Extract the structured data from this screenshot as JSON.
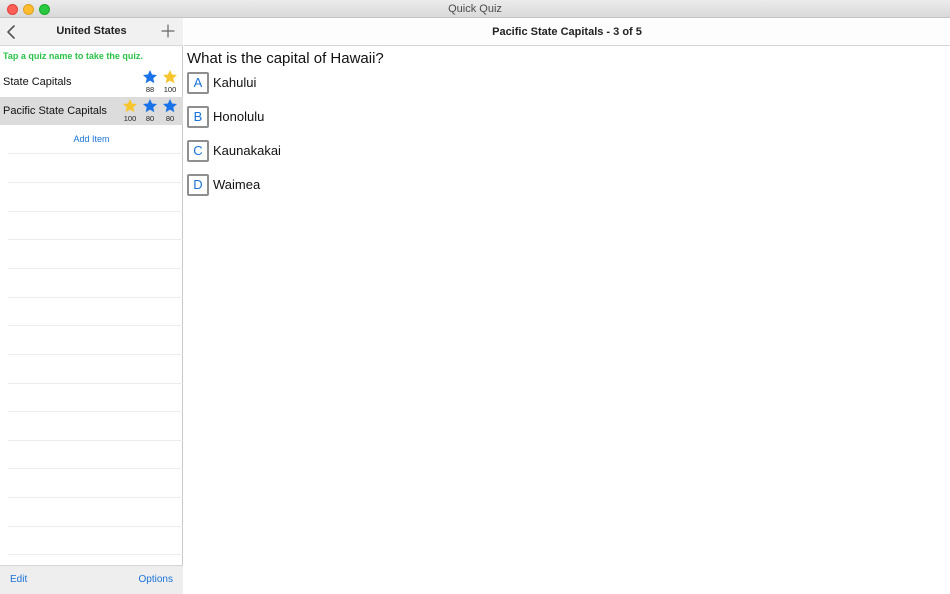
{
  "window": {
    "title": "Quick Quiz"
  },
  "sidebar": {
    "title": "United States",
    "hint": "Tap a quiz name to take the quiz.",
    "quizzes": [
      {
        "name": "State Capitals",
        "scores": [
          {
            "value": "88",
            "star": "blue"
          },
          {
            "value": "100",
            "star": "gold"
          }
        ]
      },
      {
        "name": "Pacific State Capitals",
        "scores": [
          {
            "value": "100",
            "star": "gold"
          },
          {
            "value": "80",
            "star": "blue"
          },
          {
            "value": "80",
            "star": "blue"
          }
        ]
      }
    ],
    "add_item": "Add Item",
    "footer": {
      "edit": "Edit",
      "options": "Options"
    }
  },
  "main": {
    "title": "Pacific State Capitals - 3 of 5",
    "question": "What is the capital of Hawaii?",
    "answers": [
      {
        "letter": "A",
        "text": "Kahului"
      },
      {
        "letter": "B",
        "text": "Honolulu"
      },
      {
        "letter": "C",
        "text": "Kaunakakai"
      },
      {
        "letter": "D",
        "text": "Waimea"
      }
    ]
  },
  "colors": {
    "accent_blue": "#1a73d9",
    "hint_green": "#2bc248",
    "star_gold": "#f7c62f",
    "star_blue": "#1a73e8",
    "selected_row": "#dcdcdc"
  },
  "icons": {
    "back": "chevron-left-icon",
    "add": "plus-icon",
    "score": "star-icon"
  }
}
